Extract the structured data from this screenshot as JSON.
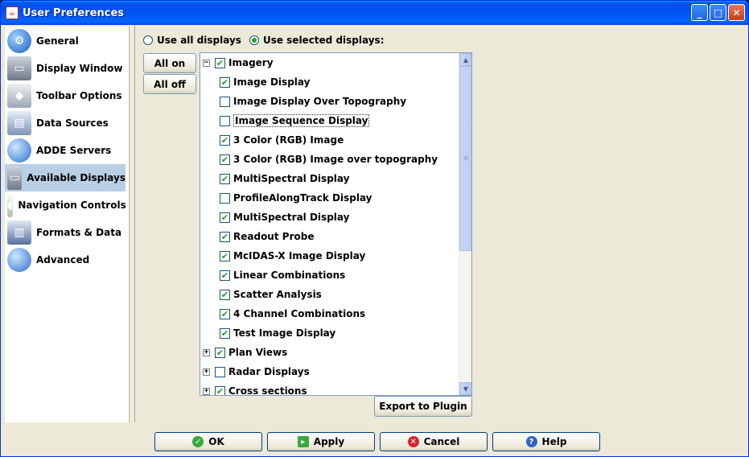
{
  "window": {
    "title": "User Preferences",
    "minimize": "_",
    "maximize": "□",
    "close": "✕"
  },
  "sidebar": {
    "items": [
      {
        "label": "General",
        "icon": "globe-gear-icon"
      },
      {
        "label": "Display Window",
        "icon": "monitor-icon"
      },
      {
        "label": "Toolbar Options",
        "icon": "toolbar-icon"
      },
      {
        "label": "Data Sources",
        "icon": "data-sources-icon"
      },
      {
        "label": "ADDE Servers",
        "icon": "globe-icon"
      },
      {
        "label": "Available Displays",
        "icon": "monitor-icon"
      },
      {
        "label": "Navigation Controls",
        "icon": "mouse-icon"
      },
      {
        "label": "Formats & Data",
        "icon": "formats-icon"
      },
      {
        "label": "Advanced",
        "icon": "globe-icon"
      }
    ],
    "selected_index": 5
  },
  "main": {
    "radio_all": "Use all displays",
    "radio_selected": "Use selected displays:",
    "all_on": "All on",
    "all_off": "All off",
    "export": "Export to Plugin"
  },
  "tree": {
    "rows": [
      {
        "label": "Imagery",
        "checked": true,
        "level": 0,
        "expander": "−"
      },
      {
        "label": "Image Display",
        "checked": true,
        "level": 1
      },
      {
        "label": "Image Display Over Topography",
        "checked": false,
        "level": 1
      },
      {
        "label": "Image Sequence Display",
        "checked": false,
        "level": 1,
        "focused": true
      },
      {
        "label": "3 Color (RGB) Image",
        "checked": true,
        "level": 1
      },
      {
        "label": "3 Color (RGB) Image over topography",
        "checked": true,
        "level": 1
      },
      {
        "label": "MultiSpectral Display",
        "checked": true,
        "level": 1
      },
      {
        "label": "ProfileAlongTrack Display",
        "checked": false,
        "level": 1
      },
      {
        "label": "MultiSpectral Display",
        "checked": true,
        "level": 1
      },
      {
        "label": "Readout Probe",
        "checked": true,
        "level": 1
      },
      {
        "label": "McIDAS-X Image Display",
        "checked": true,
        "level": 1
      },
      {
        "label": "Linear Combinations",
        "checked": true,
        "level": 1
      },
      {
        "label": "Scatter Analysis",
        "checked": true,
        "level": 1
      },
      {
        "label": "4 Channel Combinations",
        "checked": true,
        "level": 1
      },
      {
        "label": "Test Image Display",
        "checked": true,
        "level": 1
      },
      {
        "label": "Plan Views",
        "checked": true,
        "level": 0,
        "expander": "+"
      },
      {
        "label": "Radar Displays",
        "checked": false,
        "level": 0,
        "expander": "+"
      },
      {
        "label": "Cross sections",
        "checked": true,
        "level": 0,
        "expander": "+"
      }
    ]
  },
  "footer": {
    "ok": "OK",
    "apply": "Apply",
    "cancel": "Cancel",
    "help": "Help"
  },
  "colors": {
    "title_bar": "#0053ee",
    "selected_bg": "#b8cfe5",
    "check_green": "#21a121"
  }
}
